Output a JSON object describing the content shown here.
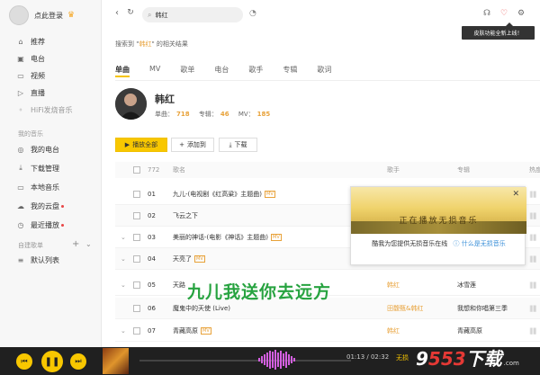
{
  "sidebar": {
    "user_name": "点此登录",
    "nav": [
      {
        "label": "推荐",
        "icon": "home-icon"
      },
      {
        "label": "电台",
        "icon": "radio-icon"
      },
      {
        "label": "视频",
        "icon": "video-icon"
      },
      {
        "label": "直播",
        "icon": "live-icon"
      },
      {
        "label": "HiFi发烧音乐",
        "icon": "hifi-icon"
      }
    ],
    "my_music_title": "我的音乐",
    "my_music": [
      {
        "label": "我的电台",
        "icon": "my-radio-icon"
      },
      {
        "label": "下载管理",
        "icon": "download-icon"
      },
      {
        "label": "本地音乐",
        "icon": "local-music-icon"
      },
      {
        "label": "我的云盘",
        "icon": "cloud-icon"
      },
      {
        "label": "最近播放",
        "icon": "recent-icon"
      }
    ],
    "playlist_title": "自建歌单",
    "playlist_items": [
      {
        "label": "默认列表",
        "icon": "list-icon"
      }
    ]
  },
  "search": {
    "value": "韩红"
  },
  "tooltip": "皮肤功能全新上线！",
  "hint": {
    "prefix": "搜索到 \"",
    "keyword": "韩红",
    "suffix": "\" 的相关结果"
  },
  "tabs": [
    "单曲",
    "MV",
    "歌单",
    "电台",
    "歌手",
    "专辑",
    "歌词"
  ],
  "artist": {
    "name": "韩红",
    "songs_label": "单曲：",
    "songs": "718",
    "albums_label": "专辑：",
    "albums": "46",
    "mv_label": "MV：",
    "mv": "185"
  },
  "actions": {
    "play_all": "播放全部",
    "add_to": "添加到",
    "download": "下载"
  },
  "table": {
    "count": "772",
    "headers": {
      "name": "歌名",
      "artist": "歌手",
      "album": "专辑",
      "hot": "热度"
    },
    "rows": [
      {
        "num": "01",
        "name": "九儿-(电视剧《红高粱》主题曲)",
        "mv": "MV",
        "artist": "",
        "album": "",
        "expand": false
      },
      {
        "num": "02",
        "name": "飞云之下",
        "mv": "",
        "artist": "",
        "album": "",
        "expand": false
      },
      {
        "num": "03",
        "name": "美丽的神话-(电影《神话》主题曲)",
        "mv": "MV",
        "artist": "",
        "album": "",
        "expand": true
      },
      {
        "num": "04",
        "name": "天亮了",
        "mv": "MV",
        "artist": "",
        "album": "",
        "expand": true
      },
      {
        "num": "05",
        "name": "天路",
        "mv": "",
        "artist": "韩红",
        "album": "冰雪莲",
        "expand": true
      },
      {
        "num": "06",
        "name": "魔鬼中的天使 (Live)",
        "mv": "",
        "artist": "田馥甄&韩红",
        "album": "我想和你唱第三季",
        "expand": false
      },
      {
        "num": "07",
        "name": "青藏高原",
        "mv": "MV",
        "artist": "韩红",
        "album": "青藏高原",
        "expand": true
      }
    ]
  },
  "popup": {
    "title": "正在播放无损音乐",
    "message": "酷我为您提供无损音乐在线",
    "link": "什么是无损音乐"
  },
  "overlay_text": "九儿我送你去远方",
  "player": {
    "time": "01:13 / 02:32",
    "quality": "无损"
  },
  "watermark": {
    "num1": "9",
    "num2": "553",
    "text": "下载",
    "sub": ".com"
  }
}
